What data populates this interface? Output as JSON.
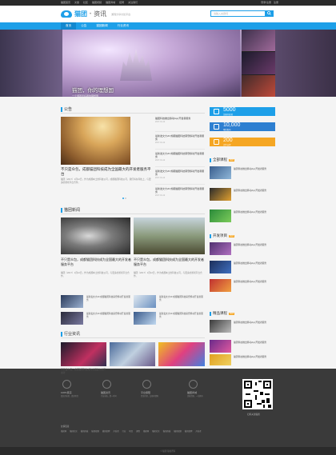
{
  "topbar": {
    "left_links": [
      "猫团首页",
      "文章",
      "社区",
      "猫团视频",
      "猫团商城",
      "招聘",
      "关注我们"
    ],
    "right_links": [
      "登录/注册",
      "注册"
    ]
  },
  "header": {
    "brand": "猫团",
    "dot": "•",
    "section": "资讯",
    "slogan": "游戏分享讨论平台",
    "search_placeholder": "请输入关键词"
  },
  "nav": {
    "items": [
      "首页",
      "公告",
      "猫团新闻",
      "行业资讯"
    ]
  },
  "banner": {
    "caption": "猫团，你的理想国",
    "subcaption": "一个游戏爱好者的理想国"
  },
  "announcements": {
    "title": "公告",
    "featured_title": "不只是众包，成都猫团科技成为全国最大的开发者服务平台",
    "featured_summary": "猫团（2017）1月12日，作为成都本土的科技公司，成都猫团科技公司，我们将在科技上，与更多的游戏平台合作。",
    "featured_meta": "2017-01-12",
    "list": [
      {
        "title": "猫团科技推出移动App开发者服务",
        "meta": "2017-01-12"
      },
      {
        "title": "最新发文大20 成都猫团科技荣登移动开发者服务",
        "meta": "2017-01-12"
      },
      {
        "title": "最新发文大20 成都猫团科技荣登移动开发者服务",
        "meta": "2017-01-12"
      },
      {
        "title": "最新发文大20 成都猫团科技荣登移动开发者服务",
        "meta": "2017-01-12"
      },
      {
        "title": "最新发文大20 成都猫团科技荣登移动开发者服务",
        "meta": "2017-01-12"
      }
    ]
  },
  "stats": [
    {
      "num": "5000",
      "label": "注册开发者",
      "color": "#1d9fe8"
    },
    {
      "num": "10,000",
      "label": "项目发布",
      "color": "#2d7fd1"
    },
    {
      "num": "200",
      "label": "合作伙伴",
      "color": "#f5a623"
    }
  ],
  "news": {
    "title": "猫团新闻",
    "items": [
      {
        "title": "不只是众包，成都猫团科技成为全国最大的开发者服务平台",
        "summary": "猫团（2017）1月12日，作为成都本土的科技公司，与更多的游戏平台合作。",
        "meta": "2017-01-12"
      },
      {
        "title": "不只是众包，成都猫团科技成为全国最大的开发者服务平台",
        "summary": "猫团（2017）1月12日，作为成都本土的科技公司，与更多的游戏平台合作。",
        "meta": "2017-01-12"
      }
    ],
    "small_items": [
      {
        "title": "最新发文大20 成都猫团科技荣登移动开发者服务"
      },
      {
        "title": "最新发文大20 成都猫团科技荣登移动开发者服务"
      },
      {
        "title": "最新发文大20 成都猫团科技荣登移动开发者服务"
      },
      {
        "title": "最新发文大20 成都猫团科技荣登移动开发者服务"
      }
    ]
  },
  "industry": {
    "title": "行业资讯",
    "items": [
      {
        "title": "不只是众包，成都猫团科技成为全国最大的开发者",
        "meta": "2017-01-12"
      },
      {
        "title": "不只是众包，成都猫团科技成为全国最大的开发者",
        "meta": "2017-01-12"
      },
      {
        "title": "不只是众包，成都猫团科技成为全国最大的开发者",
        "meta": "2017-01-12"
      }
    ]
  },
  "sidebar": {
    "sections": [
      {
        "title": "全部课程",
        "tag": "HOT",
        "items": [
          "猫团科技推出移动App开发者服务",
          "猫团科技推出移动App开发者服务",
          "猫团科技推出移动App开发者服务",
          "猫团科技推出移动App开发者服务"
        ]
      },
      {
        "title": "开发项目",
        "tag": "HOT",
        "items": [
          "猫团科技推出移动App开发者服务",
          "猫团科技推出移动App开发者服务",
          "猫团科技推出移动App开发者服务"
        ]
      },
      {
        "title": "精品课程",
        "tag": "HOT",
        "items": [
          "猫团科技推出移动App开发者服务",
          "猫团科技推出移动App开发者服务",
          "猫团科技推出移动App开发者服务"
        ]
      }
    ]
  },
  "footer": {
    "features": [
      {
        "title": "100%真实",
        "sub": "真实开发者，真实项目"
      },
      {
        "title": "猫团资讯",
        "sub": "行业动态，第一时间"
      },
      {
        "title": "平台保障",
        "sub": "资金托管，交易有保障"
      },
      {
        "title": "猫团商城",
        "sub": "优质资源，一站购齐"
      }
    ],
    "links_label": "友情链接",
    "links": [
      "猫团网",
      "猫团社区",
      "猫团商城",
      "猫团视频",
      "猫团招聘",
      "开发者",
      "行业",
      "项目",
      "课程",
      "猫团网",
      "猫团社区",
      "猫团商城",
      "猫团视频",
      "猫团招聘",
      "开发者"
    ],
    "qr_caption": "扫码关注猫团",
    "copyright": "© 猫团 版权所有"
  }
}
